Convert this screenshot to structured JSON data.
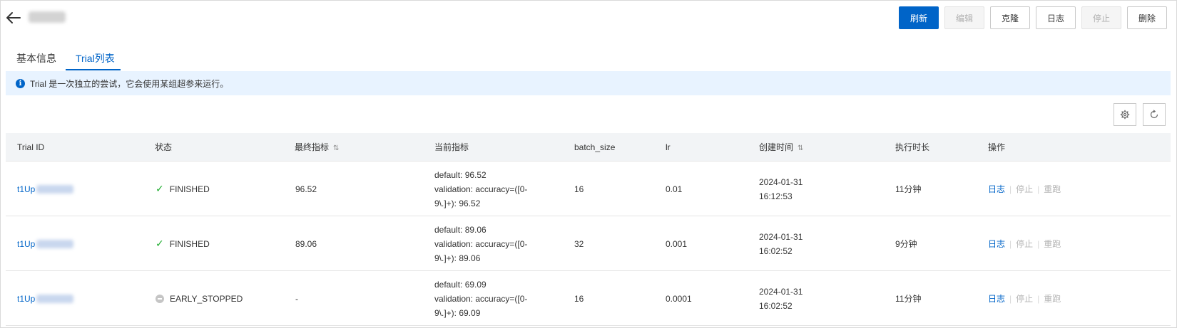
{
  "toolbar": {
    "refresh": "刷新",
    "edit": "编辑",
    "clone": "克隆",
    "logs": "日志",
    "stop": "停止",
    "delete": "删除"
  },
  "tabs": [
    {
      "label": "基本信息",
      "active": false
    },
    {
      "label": "Trial列表",
      "active": true
    }
  ],
  "info_message": "Trial 是一次独立的尝试，它会使用某组超参来运行。",
  "table": {
    "columns": [
      "Trial ID",
      "状态",
      "最终指标",
      "当前指标",
      "batch_size",
      "lr",
      "创建时间",
      "执行时长",
      "操作"
    ],
    "sortable_columns": [
      "最终指标",
      "创建时间"
    ],
    "rows": [
      {
        "trial_id_prefix": "t1Up",
        "status": "FINISHED",
        "status_icon": "check-icon",
        "final_metric": "96.52",
        "current_metric": [
          "default: 96.52",
          "validation: accuracy=([0-",
          "9\\.]+): 96.52"
        ],
        "batch_size": "16",
        "lr": "0.01",
        "created": [
          "2024-01-31",
          "16:12:53"
        ],
        "duration": "11分钟",
        "actions": [
          {
            "label": "日志",
            "enabled": true
          },
          {
            "label": "停止",
            "enabled": false
          },
          {
            "label": "重跑",
            "enabled": false
          }
        ]
      },
      {
        "trial_id_prefix": "t1Up",
        "status": "FINISHED",
        "status_icon": "check-icon",
        "final_metric": "89.06",
        "current_metric": [
          "default: 89.06",
          "validation: accuracy=([0-",
          "9\\.]+): 89.06"
        ],
        "batch_size": "32",
        "lr": "0.001",
        "created": [
          "2024-01-31",
          "16:02:52"
        ],
        "duration": "9分钟",
        "actions": [
          {
            "label": "日志",
            "enabled": true
          },
          {
            "label": "停止",
            "enabled": false
          },
          {
            "label": "重跑",
            "enabled": false
          }
        ]
      },
      {
        "trial_id_prefix": "t1Up",
        "status": "EARLY_STOPPED",
        "status_icon": "minus-circle-icon",
        "final_metric": "-",
        "current_metric": [
          "default: 69.09",
          "validation: accuracy=([0-",
          "9\\.]+): 69.09"
        ],
        "batch_size": "16",
        "lr": "0.0001",
        "created": [
          "2024-01-31",
          "16:02:52"
        ],
        "duration": "11分钟",
        "actions": [
          {
            "label": "日志",
            "enabled": true
          },
          {
            "label": "停止",
            "enabled": false
          },
          {
            "label": "重跑",
            "enabled": false
          }
        ]
      }
    ]
  },
  "icons": {
    "back": "arrow-left-icon",
    "settings": "gear-icon",
    "reload": "refresh-icon",
    "info": "info-circle-icon"
  },
  "colors": {
    "primary": "#0064c8",
    "success": "#1fad2f",
    "info_bg": "#e8f3ff"
  }
}
